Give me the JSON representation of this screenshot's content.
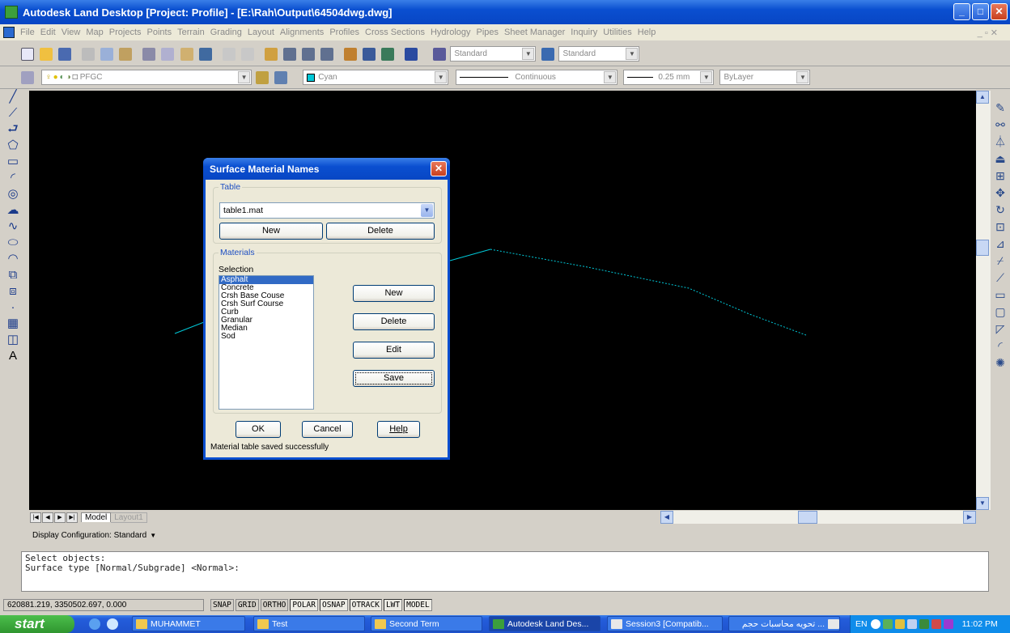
{
  "window": {
    "title": "Autodesk Land Desktop [Project: Profile] - [E:\\Rah\\Output\\64504dwg.dwg]"
  },
  "menu": [
    "File",
    "Edit",
    "View",
    "Map",
    "Projects",
    "Points",
    "Terrain",
    "Grading",
    "Layout",
    "Alignments",
    "Profiles",
    "Cross Sections",
    "Hydrology",
    "Pipes",
    "Sheet Manager",
    "Inquiry",
    "Utilities",
    "Help"
  ],
  "toolbar": {
    "text_style": "Standard",
    "dim_style": "Standard",
    "layer": "PFGC",
    "color": "Cyan",
    "linetype": "Continuous",
    "lineweight": "0.25 mm",
    "plotstyle": "ByLayer"
  },
  "tabs": {
    "model": "Model",
    "layout": "Layout1"
  },
  "display_config": "Display Configuration:  Standard",
  "command_lines": [
    "Select objects:",
    "Surface type [Normal/Subgrade] <Normal>:"
  ],
  "status": {
    "coords": "620881.219, 3350502.697, 0.000",
    "buttons": [
      "SNAP",
      "GRID",
      "ORTHO",
      "POLAR",
      "OSNAP",
      "OTRACK",
      "LWT",
      "MODEL"
    ]
  },
  "dialog": {
    "title": "Surface Material Names",
    "table_group": "Table",
    "table_value": "table1.mat",
    "table_new": "New",
    "table_delete": "Delete",
    "materials_group": "Materials",
    "selection_label": "Selection",
    "materials": [
      "Asphalt",
      "Concrete",
      "Crsh Base Couse",
      "Crsh Surf Course",
      "Curb",
      "Granular",
      "Median",
      "Sod"
    ],
    "selected_material": "Asphalt",
    "btn_new": "New",
    "btn_delete": "Delete",
    "btn_edit": "Edit",
    "btn_save": "Save",
    "btn_ok": "OK",
    "btn_cancel": "Cancel",
    "btn_help": "Help",
    "status_message": "Material table saved successfully"
  },
  "taskbar": {
    "start": "start",
    "tasks": [
      "MUHAMMET",
      "Test",
      "Second Term",
      "Autodesk Land Des...",
      "Session3 [Compatib...",
      "... تحويه محاسبات حجم"
    ],
    "lang": "EN",
    "clock": "11:02 PM"
  },
  "colors": {
    "drawing_bg": "#000000",
    "profile_line": "#00c8d8",
    "xp_blue": "#0a4fd0"
  }
}
